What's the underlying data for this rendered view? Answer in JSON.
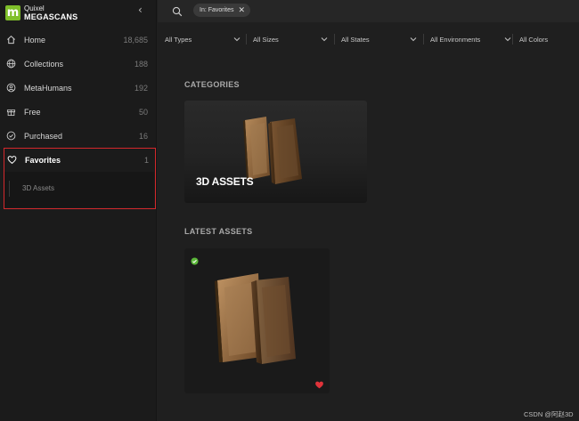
{
  "brand": {
    "top": "Quixel",
    "bottom": "MEGASCANS",
    "logo_letter": "m",
    "accent": "#7fbf2a"
  },
  "sidebar": {
    "collapse_glyph": "‹",
    "items": [
      {
        "label": "Home",
        "count": "18,685",
        "icon": "home-icon"
      },
      {
        "label": "Collections",
        "count": "188",
        "icon": "globe-icon"
      },
      {
        "label": "MetaHumans",
        "count": "192",
        "icon": "user-circle-icon"
      },
      {
        "label": "Free",
        "count": "50",
        "icon": "gift-icon"
      },
      {
        "label": "Purchased",
        "count": "16",
        "icon": "check-circle-icon"
      }
    ],
    "favorites": {
      "label": "Favorites",
      "count": "1",
      "icon": "heart-icon",
      "sub_label": "3D Assets",
      "highlight": "#d4282c"
    }
  },
  "search": {
    "chip_label": "In: Favorites",
    "chip_close": "✕"
  },
  "filters": [
    {
      "label": "All Types"
    },
    {
      "label": "All Sizes"
    },
    {
      "label": "All States"
    },
    {
      "label": "All Environments"
    },
    {
      "label": "All Colors"
    }
  ],
  "main": {
    "categories_title": "CATEGORIES",
    "category_card_label": "3D ASSETS",
    "latest_title": "LATEST ASSETS",
    "status_color": "#5cb83a",
    "favorite_color": "#e0333a"
  },
  "watermark": "CSDN @阿赵3D"
}
